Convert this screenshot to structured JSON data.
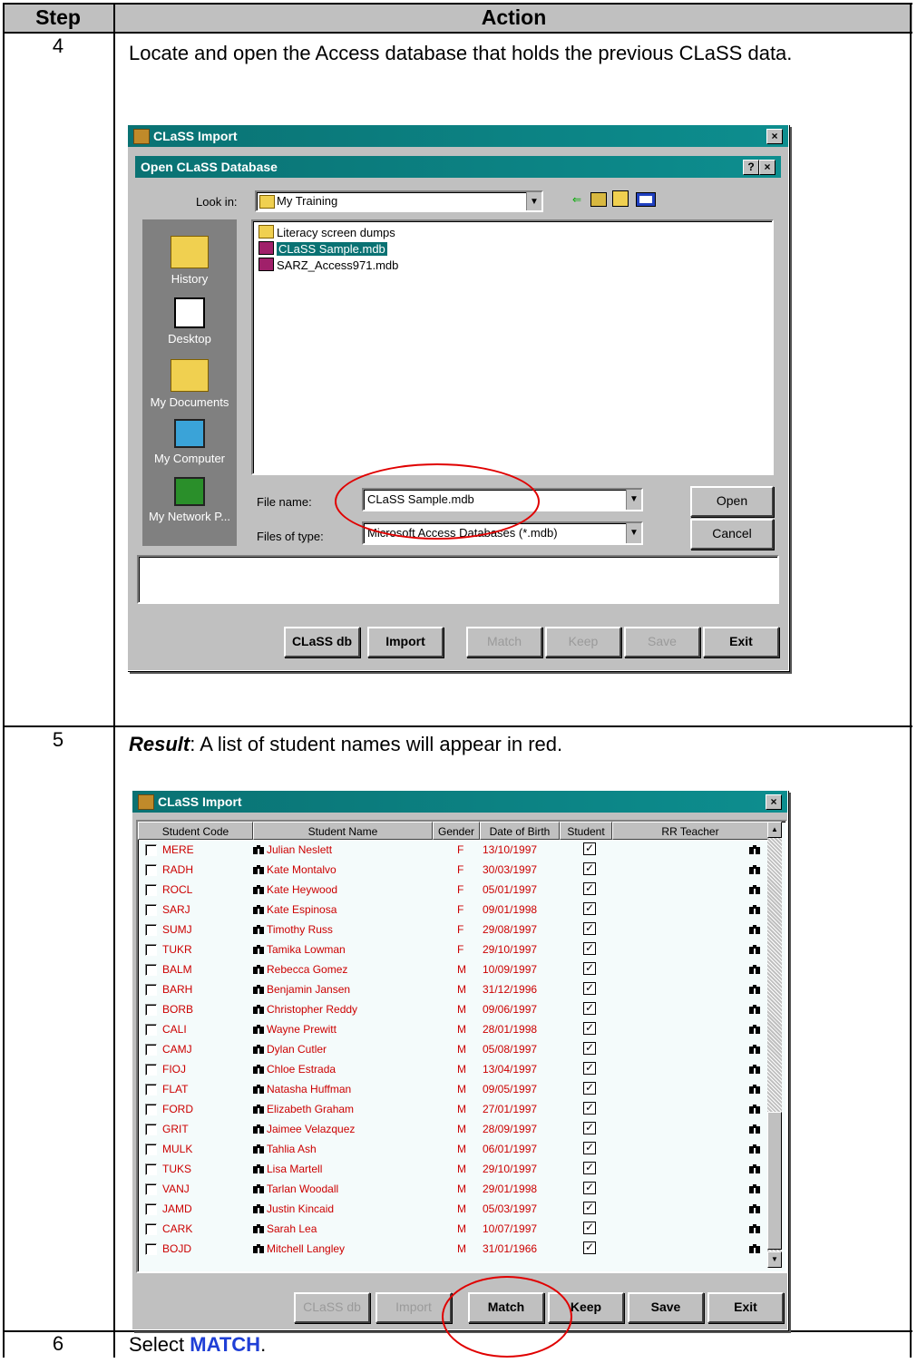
{
  "table": {
    "header": {
      "step": "Step",
      "action": "Action"
    },
    "rows": [
      {
        "step": "4",
        "action": "Locate and open the Access database that holds the previous CLaSS data."
      },
      {
        "step": "5",
        "result_label": "Result",
        "action": ":  A list of student names will appear in red."
      },
      {
        "step": "6",
        "action_prefix": "Select ",
        "action_highlight": "MATCH",
        "action_suffix": "."
      }
    ]
  },
  "screenshot1": {
    "outer_title": "CLaSS Import",
    "dialog_title": "Open CLaSS Database",
    "look_in_label": "Look in:",
    "look_in_value": "My Training",
    "files": [
      "Literacy screen dumps",
      "CLaSS Sample.mdb",
      "SARZ_Access971.mdb"
    ],
    "places": [
      "History",
      "Desktop",
      "My Documents",
      "My Computer",
      "My Network P..."
    ],
    "file_name_label": "File name:",
    "file_name_value": "CLaSS Sample.mdb",
    "file_type_label": "Files of type:",
    "file_type_value": "Microsoft Access Databases (*.mdb)",
    "open_button": "Open",
    "cancel_button": "Cancel",
    "help_button": "?",
    "close_button": "×",
    "bottom_buttons": [
      "CLaSS db",
      "Import",
      "Match",
      "Keep",
      "Save",
      "Exit"
    ]
  },
  "screenshot2": {
    "title": "CLaSS Import",
    "close_button": "×",
    "columns": [
      "Student Code",
      "Student Name",
      "Gender",
      "Date of Birth",
      "Student",
      "RR Teacher"
    ],
    "students": [
      {
        "code": "MERE",
        "name": "Julian Neslett",
        "gender": "F",
        "dob": "13/10/1997"
      },
      {
        "code": "RADH",
        "name": "Kate Montalvo",
        "gender": "F",
        "dob": "30/03/1997"
      },
      {
        "code": "ROCL",
        "name": "Kate Heywood",
        "gender": "F",
        "dob": "05/01/1997"
      },
      {
        "code": "SARJ",
        "name": "Kate Espinosa",
        "gender": "F",
        "dob": "09/01/1998"
      },
      {
        "code": "SUMJ",
        "name": "Timothy Russ",
        "gender": "F",
        "dob": "29/08/1997"
      },
      {
        "code": "TUKR",
        "name": "Tamika Lowman",
        "gender": "F",
        "dob": "29/10/1997"
      },
      {
        "code": "BALM",
        "name": "Rebecca Gomez",
        "gender": "M",
        "dob": "10/09/1997"
      },
      {
        "code": "BARH",
        "name": "Benjamin Jansen",
        "gender": "M",
        "dob": "31/12/1996"
      },
      {
        "code": "BORB",
        "name": "Christopher Reddy",
        "gender": "M",
        "dob": "09/06/1997"
      },
      {
        "code": "CALI",
        "name": "Wayne Prewitt",
        "gender": "M",
        "dob": "28/01/1998"
      },
      {
        "code": "CAMJ",
        "name": "Dylan Cutler",
        "gender": "M",
        "dob": "05/08/1997"
      },
      {
        "code": "FIOJ",
        "name": "Chloe Estrada",
        "gender": "M",
        "dob": "13/04/1997"
      },
      {
        "code": "FLAT",
        "name": "Natasha Huffman",
        "gender": "M",
        "dob": "09/05/1997"
      },
      {
        "code": "FORD",
        "name": "Elizabeth Graham",
        "gender": "M",
        "dob": "27/01/1997"
      },
      {
        "code": "GRIT",
        "name": "Jaimee Velazquez",
        "gender": "M",
        "dob": "28/09/1997"
      },
      {
        "code": "MULK",
        "name": "Tahlia Ash",
        "gender": "M",
        "dob": "06/01/1997"
      },
      {
        "code": "TUKS",
        "name": "Lisa Martell",
        "gender": "M",
        "dob": "29/10/1997"
      },
      {
        "code": "VANJ",
        "name": "Tarlan Woodall",
        "gender": "M",
        "dob": "29/01/1998"
      },
      {
        "code": "JAMD",
        "name": "Justin Kincaid",
        "gender": "M",
        "dob": "05/03/1997"
      },
      {
        "code": "CARK",
        "name": "Sarah Lea",
        "gender": "M",
        "dob": "10/07/1997"
      },
      {
        "code": "BOJD",
        "name": "Mitchell Langley",
        "gender": "M",
        "dob": "31/01/1966"
      }
    ],
    "bottom_buttons": [
      "CLaSS db",
      "Import",
      "Match",
      "Keep",
      "Save",
      "Exit"
    ]
  },
  "colors": {
    "header_bg": "#c0c0c0",
    "titlebar": "#0d8e8f",
    "student_text": "#cc0000",
    "highlight_oval": "#e00000",
    "match_link": "#1f3fd6"
  }
}
